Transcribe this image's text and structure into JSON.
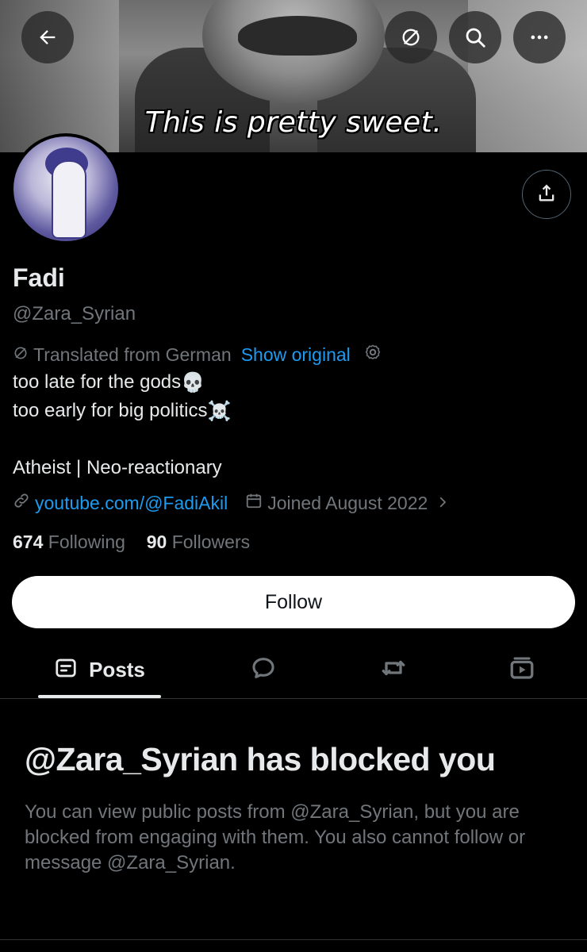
{
  "banner": {
    "caption": "This is pretty sweet."
  },
  "header_buttons": {
    "back_icon": "arrow-left-icon",
    "translate_icon": "translate-off-icon",
    "search_icon": "search-icon",
    "more_icon": "more-horizontal-icon"
  },
  "profile": {
    "name": "Fadi",
    "handle": "@Zara_Syrian",
    "translated_note": "Translated from German",
    "show_original": "Show original",
    "bio_line1": "too late for the gods",
    "bio_line1_emoji": "💀",
    "bio_line2": "too early for big politics",
    "bio_line2_emoji": "☠️",
    "bio_line3": "Atheist | Neo-reactionary",
    "link": "youtube.com/@FadiAkil",
    "joined": "Joined August 2022",
    "following_count": "674",
    "following_label": "Following",
    "followers_count": "90",
    "followers_label": "Followers"
  },
  "actions": {
    "follow_label": "Follow"
  },
  "tabs": {
    "posts_label": "Posts"
  },
  "blocked": {
    "title": "@Zara_Syrian has blocked you",
    "description": "You can view public posts from @Zara_Syrian, but you are blocked from engaging with them. You also cannot follow or message @Zara_Syrian."
  },
  "colors": {
    "accent": "#1d9bf0",
    "muted": "#71767b",
    "text": "#e7e9ea",
    "background": "#000000"
  }
}
